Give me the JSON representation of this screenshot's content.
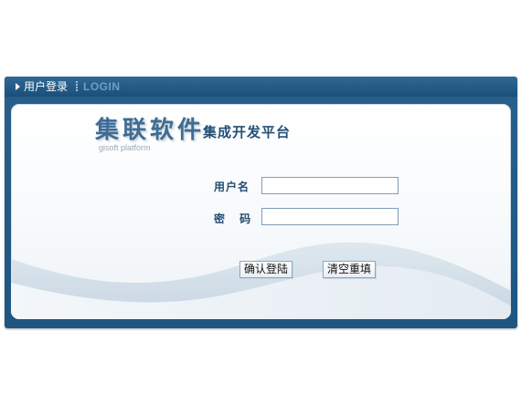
{
  "window": {
    "title": "用户登录",
    "subtitle": "LOGIN"
  },
  "brand": {
    "name": "集联软件",
    "tagline": "集成开发平台",
    "english": "gisoft platform"
  },
  "form": {
    "username_label": "用户名",
    "password_label": "密 码",
    "username_value": "",
    "password_value": ""
  },
  "buttons": {
    "confirm": "确认登陆",
    "reset": "清空重填"
  },
  "colors": {
    "frame": "#1f5581",
    "label": "#244d72",
    "brand": "#3f6c93"
  }
}
